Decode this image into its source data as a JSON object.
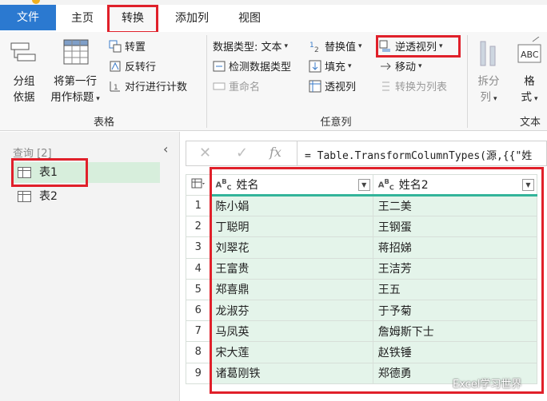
{
  "tabs": {
    "file": "文件",
    "home": "主页",
    "transform": "转换",
    "add_column": "添加列",
    "view": "视图"
  },
  "ribbon": {
    "table_group": {
      "group_by": [
        "分组",
        "依据"
      ],
      "use_first_row": [
        "将第一行",
        "用作标题"
      ],
      "transpose": "转置",
      "reverse_rows": "反转行",
      "count_rows": "对行进行计数",
      "label": "表格"
    },
    "any_column_group": {
      "data_type": "数据类型: 文本",
      "detect_type": "检测数据类型",
      "rename": "重命名",
      "replace_values": "替换值",
      "fill": "填充",
      "pivot_column": "透视列",
      "unpivot_columns": "逆透视列",
      "move": "移动",
      "convert_to_list": "转换为列表",
      "label": "任意列"
    },
    "text_group": {
      "split": [
        "拆分",
        "列"
      ],
      "format": [
        "格",
        "式"
      ],
      "label": "文本"
    }
  },
  "queries": {
    "header": "查询 [2]",
    "items": [
      "表1",
      "表2"
    ],
    "selected": "表1"
  },
  "formula": {
    "cancel": "✕",
    "confirm": "✓",
    "fx": "fx",
    "text": "= Table.TransformColumnTypes(源,{{\"姓"
  },
  "table": {
    "columns": [
      "姓名",
      "姓名2"
    ],
    "column_type_icon": "ABC",
    "rows": [
      [
        "1",
        "陈小娟",
        "王二美"
      ],
      [
        "2",
        "丁聪明",
        "王钢蛋"
      ],
      [
        "3",
        "刘翠花",
        "蒋招娣"
      ],
      [
        "4",
        "王富贵",
        "王洁芳"
      ],
      [
        "5",
        "郑喜鼎",
        "王五"
      ],
      [
        "6",
        "龙淑芬",
        "于予菊"
      ],
      [
        "7",
        "马凤英",
        "詹姆斯下士"
      ],
      [
        "8",
        "宋大莲",
        "赵铁锤"
      ],
      [
        "9",
        "诸葛刚铁",
        "郑德勇"
      ]
    ]
  },
  "watermark": "Excel学习世界",
  "colors": {
    "file_tab": "#2b79d0",
    "highlight_box": "#e0202a",
    "selected_query": "#d7eedc",
    "cell_bg": "#e4f4ea",
    "header_underline": "#33b49a"
  }
}
